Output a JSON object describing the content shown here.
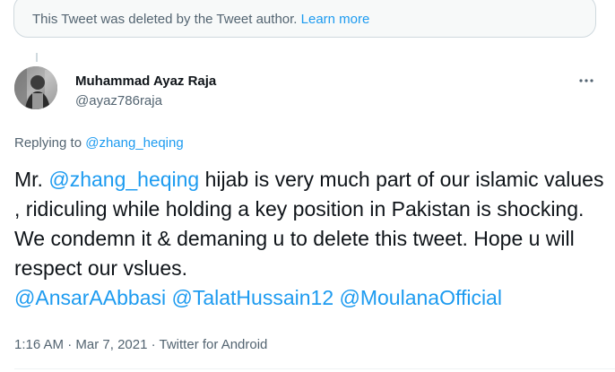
{
  "deleted_notice": {
    "text": "This Tweet was deleted by the Tweet author.",
    "learn_more": "Learn more"
  },
  "tweet": {
    "author_name": "Muhammad Ayaz Raja",
    "author_handle": "@ayaz786raja",
    "more_icon": "more-horizontal-icon",
    "replying_prefix": "Replying to",
    "replying_handle": "@zhang_heqing",
    "body": {
      "prefix": "Mr. ",
      "mention_1": "@zhang_heqing",
      "text_main": " hijab is very much part of our islamic values , ridiculing while holding a key position in Pakistan is shocking. We condemn it & demaning u to delete this tweet. Hope u will respect our vslues.",
      "mention_2": "@AnsarAAbbasi",
      "mention_3": "@TalatHussain12",
      "mention_4": "@MoulanaOfficial"
    },
    "time": "1:16 AM",
    "date": "Mar 7, 2021",
    "source": "Twitter for Android",
    "separator": "·"
  },
  "colors": {
    "link": "#1d9bf0",
    "secondary_text": "#536471",
    "primary_text": "#0f1419",
    "notice_bg": "#f7f9f9",
    "border": "#cfd9de"
  }
}
